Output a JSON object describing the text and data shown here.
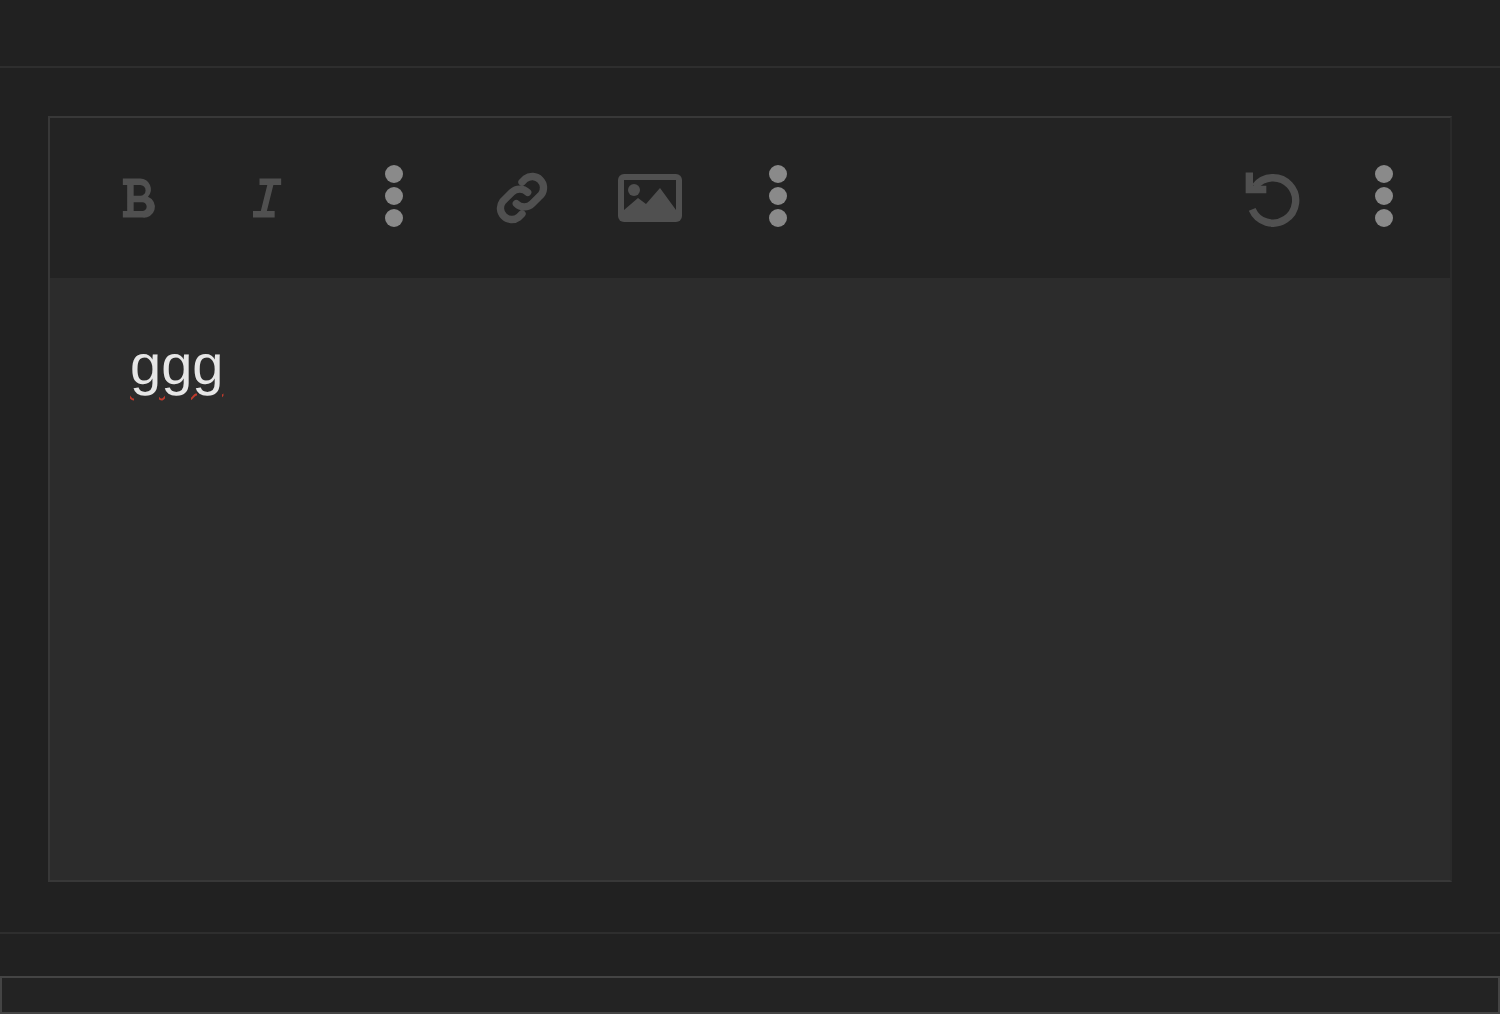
{
  "editor": {
    "toolbar": {
      "left": [
        {
          "kind": "bold",
          "disabled": true
        },
        {
          "kind": "italic",
          "disabled": true
        },
        {
          "kind": "more",
          "disabled": false
        },
        {
          "kind": "link",
          "disabled": true
        },
        {
          "kind": "image",
          "disabled": true
        },
        {
          "kind": "more",
          "disabled": false
        }
      ],
      "right": [
        {
          "kind": "undo",
          "disabled": true
        },
        {
          "kind": "more",
          "disabled": false
        }
      ]
    },
    "content": {
      "text": "ggg",
      "misspelled": true
    }
  }
}
